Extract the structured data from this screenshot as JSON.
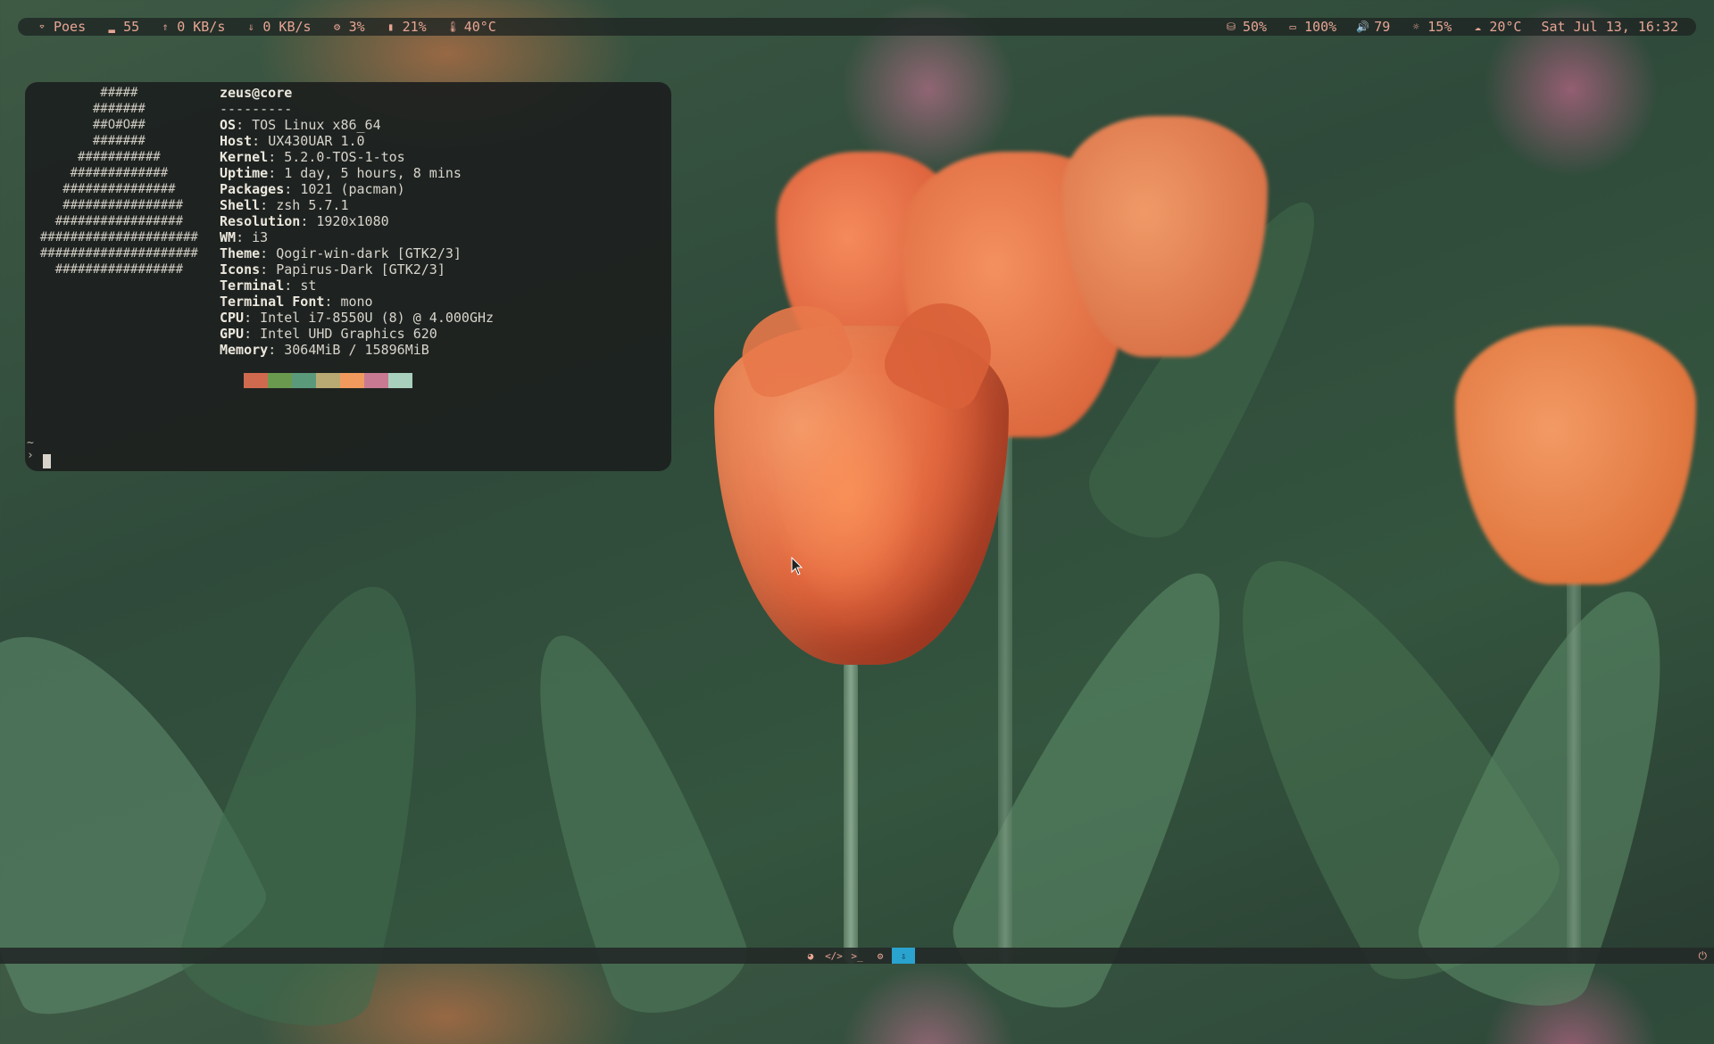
{
  "topbar": {
    "left": [
      {
        "icon": "wifi-icon",
        "glyph": "⌔",
        "label": "Poes"
      },
      {
        "icon": "signal-icon",
        "glyph": "▂",
        "label": "55"
      },
      {
        "icon": "upload-icon",
        "glyph": "⇑",
        "label": "0 KB/s"
      },
      {
        "icon": "download-icon",
        "glyph": "⇓",
        "label": "0 KB/s"
      },
      {
        "icon": "cpu-icon",
        "glyph": "⚙",
        "label": "3%"
      },
      {
        "icon": "memory-icon",
        "glyph": "▮",
        "label": "21%"
      },
      {
        "icon": "temperature-icon",
        "glyph": "🌡",
        "label": "40°C"
      }
    ],
    "right": [
      {
        "icon": "disk-icon",
        "glyph": "⛁",
        "label": "50%"
      },
      {
        "icon": "battery-icon",
        "glyph": "▭",
        "label": "100%"
      },
      {
        "icon": "volume-icon",
        "glyph": "🔊",
        "label": "79"
      },
      {
        "icon": "brightness-icon",
        "glyph": "☼",
        "label": "15%"
      },
      {
        "icon": "weather-icon",
        "glyph": "☁",
        "label": "20°C"
      },
      {
        "icon": "",
        "glyph": "",
        "label": "Sat Jul 13, 16:32"
      }
    ]
  },
  "terminal": {
    "ascii_logo": "          #####\n         #######\n         ##O#O##\n         #######\n       ###########\n      #############\n     ###############\n     ################\n    #################\n  #####################\n  #####################\n    #################",
    "user_host": "zeus@core",
    "separator": "---------",
    "info": [
      {
        "key": "OS",
        "value": "TOS Linux x86_64"
      },
      {
        "key": "Host",
        "value": "UX430UAR 1.0"
      },
      {
        "key": "Kernel",
        "value": "5.2.0-TOS-1-tos"
      },
      {
        "key": "Uptime",
        "value": "1 day, 5 hours, 8 mins"
      },
      {
        "key": "Packages",
        "value": "1021 (pacman)"
      },
      {
        "key": "Shell",
        "value": "zsh 5.7.1"
      },
      {
        "key": "Resolution",
        "value": "1920x1080"
      },
      {
        "key": "WM",
        "value": "i3"
      },
      {
        "key": "Theme",
        "value": "Qogir-win-dark [GTK2/3]"
      },
      {
        "key": "Icons",
        "value": "Papirus-Dark [GTK2/3]"
      },
      {
        "key": "Terminal",
        "value": "st"
      },
      {
        "key": "Terminal Font",
        "value": "mono"
      },
      {
        "key": "CPU",
        "value": "Intel i7-8550U (8) @ 4.000GHz"
      },
      {
        "key": "GPU",
        "value": "Intel UHD Graphics 620"
      },
      {
        "key": "Memory",
        "value": "3064MiB / 15896MiB"
      }
    ],
    "palette": [
      "#d06a4e",
      "#6a9a4e",
      "#5a9a7a",
      "#b8aa72",
      "#f29a5e",
      "#c97a92",
      "#a9d0bc"
    ],
    "prompt_dir": "~",
    "prompt_symbol": "›"
  },
  "bottombar": {
    "workspaces": [
      {
        "icon": "firefox-icon",
        "glyph": "◕",
        "active": false
      },
      {
        "icon": "code-icon",
        "glyph": "</>",
        "active": false
      },
      {
        "icon": "terminal-icon",
        "glyph": ">_",
        "active": false
      },
      {
        "icon": "settings-icon",
        "glyph": "⚙",
        "active": false
      },
      {
        "icon": "download-icon",
        "glyph": "⇩",
        "active": true
      }
    ],
    "power_glyph": "⏻"
  }
}
